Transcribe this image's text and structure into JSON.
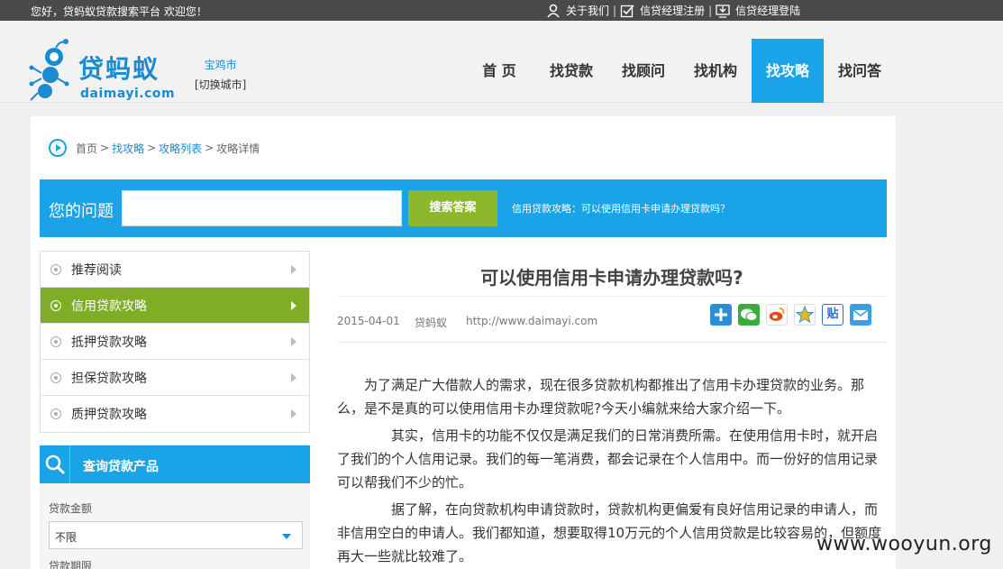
{
  "topbar": {
    "welcome": "您好，贷蚂蚁贷款搜索平台 欢迎您！",
    "links": [
      {
        "label": "关于我们",
        "icon": "user-icon"
      },
      {
        "label": "信贷经理注册",
        "icon": "checkbox-icon"
      },
      {
        "label": "信贷经理登陆",
        "icon": "monitor-icon"
      }
    ],
    "separator": "|"
  },
  "logo": {
    "brand": "贷蚂蚁",
    "sub": "daimayi.com"
  },
  "city": {
    "name": "宝鸡市",
    "switch": "[切换城市]"
  },
  "nav": {
    "items": [
      {
        "label": "首 页"
      },
      {
        "label": "找贷款"
      },
      {
        "label": "找顾问"
      },
      {
        "label": "找机构"
      },
      {
        "label": "找攻略"
      },
      {
        "label": "找问答"
      }
    ],
    "active_index": 4
  },
  "breadcrumb": {
    "home": "首页",
    "items": [
      "找攻略",
      "攻略列表"
    ],
    "current": "攻略详情",
    "sep": ">"
  },
  "search": {
    "label": "您的问题",
    "value": "",
    "button": "搜索答案",
    "hint": "信用贷款攻略：可以使用信用卡申请办理贷款吗？"
  },
  "sidebar": {
    "items": [
      {
        "label": "推荐阅读"
      },
      {
        "label": "信用贷款攻略"
      },
      {
        "label": "抵押贷款攻略"
      },
      {
        "label": "担保贷款攻略"
      },
      {
        "label": "质押贷款攻略"
      }
    ],
    "active_index": 1
  },
  "query": {
    "title": "查询贷款产品",
    "amount_label": "贷款金额",
    "amount_value": "不限",
    "term_label": "贷款期限"
  },
  "article": {
    "title": "可以使用信用卡申请办理贷款吗?",
    "date": "2015-04-01",
    "author": "贷蚂蚁",
    "url": "http://www.daimayi.com",
    "share_icons": [
      "plus-share-icon",
      "wechat-icon",
      "weibo-icon",
      "qzone-star-icon",
      "tieba-icon",
      "email-icon"
    ],
    "share_colors": [
      "#2b8fd6",
      "#3bab3b",
      "#e64a19",
      "#f5b50a",
      "#2d6fc0",
      "#3aa0e0"
    ],
    "tieba_text": "贴",
    "paragraphs": [
      "为了满足广大借款人的需求，现在很多贷款机构都推出了信用卡办理贷款的业务。那么，是不是真的可以使用信用卡办理贷款呢?今天小编就来给大家介绍一下。",
      "其实，信用卡的功能不仅仅是满足我们的日常消费所需。在使用信用卡时，就开启了我们的个人信用记录。我们的每一笔消费，都会记录在个人信用中。而一份好的信用记录可以帮我们不少的忙。",
      "据了解，在向贷款机构申请贷款时，贷款机构更偏爱有良好信用记录的申请人，而非信用空白的申请人。我们都知道，想要取得10万元的个人信用贷款是比较容易的，但额度再大一些就比较难了。"
    ]
  },
  "watermark": "www.wooyun.org"
}
